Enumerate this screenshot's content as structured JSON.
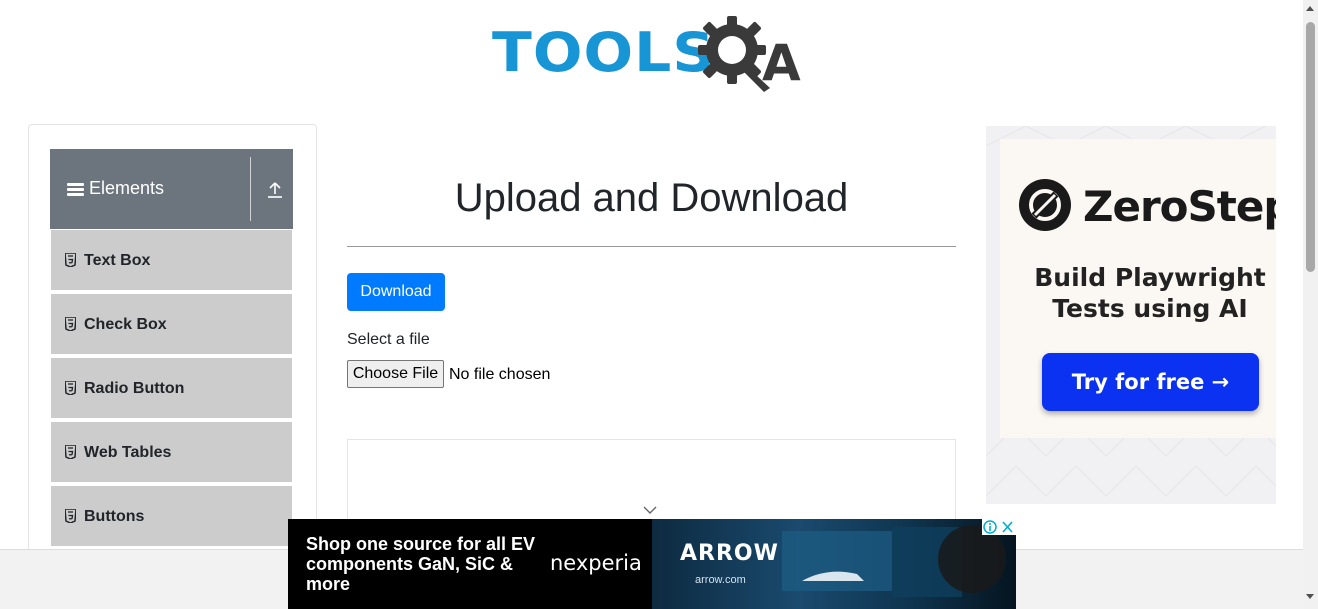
{
  "header": {
    "logo_text_tools": "TOOLS",
    "logo_text_a": "A"
  },
  "sidebar": {
    "group_title": "Elements",
    "items": [
      {
        "label": "Text Box"
      },
      {
        "label": "Check Box"
      },
      {
        "label": "Radio Button"
      },
      {
        "label": "Web Tables"
      },
      {
        "label": "Buttons"
      }
    ]
  },
  "main": {
    "title": "Upload and Download",
    "download_label": "Download",
    "select_file_label": "Select a file",
    "choose_file_label": "Choose File",
    "file_status": "No file chosen"
  },
  "side_ad": {
    "brand": "ZeroStep",
    "tagline": "Build Playwright Tests using AI",
    "cta": "Try for free →"
  },
  "bottom_ad": {
    "headline": "Shop one source for all EV components GaN, SiC & more",
    "brand": "nexperia",
    "partner": "ARROW",
    "partner_url": "arrow.com"
  },
  "colors": {
    "brand_blue": "#1795d4",
    "primary_button": "#007bff",
    "sidebar_header": "#6c757d",
    "sidebar_item": "#cccccc",
    "ad_cta": "#0a32f0"
  },
  "icons": [
    "toolsqa-gear-logo",
    "hamburger-icon",
    "upload-arrow-icon",
    "html5-icon",
    "chevron-down-icon",
    "zerostep-logo-icon",
    "ad-info-icon",
    "ad-close-icon"
  ]
}
